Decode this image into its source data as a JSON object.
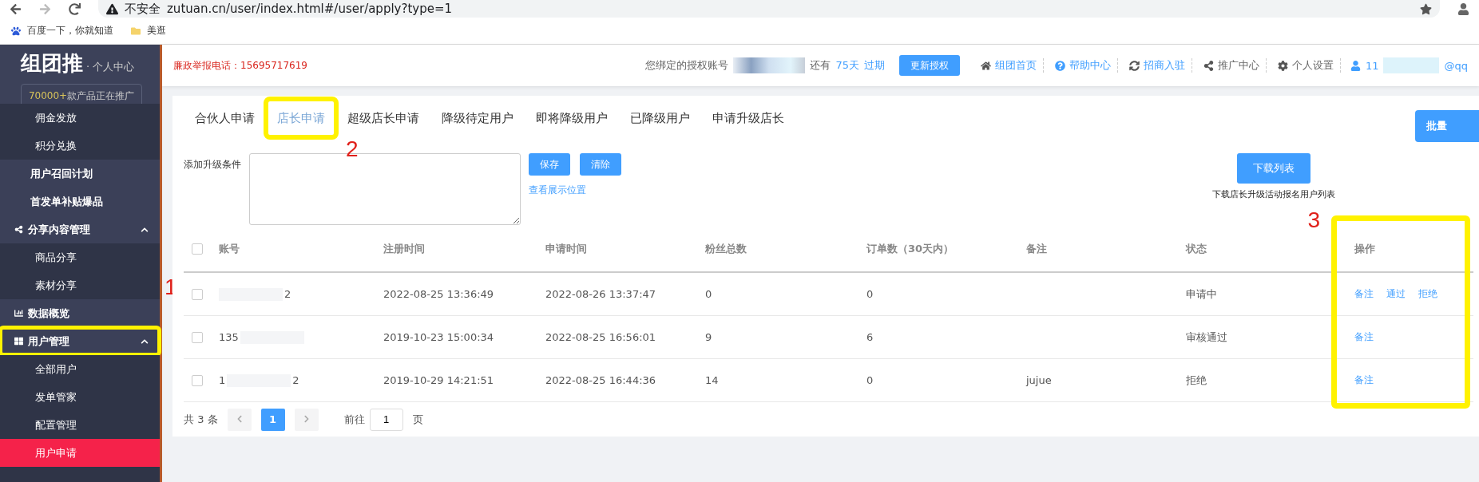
{
  "browser": {
    "security": "不安全",
    "url": "zutuan.cn/user/index.html#/user/apply?type=1",
    "bookmarks": [
      {
        "label": "百度一下，你就知道",
        "kind": "paw"
      },
      {
        "label": "美逛",
        "kind": "folder"
      }
    ]
  },
  "sidebar": {
    "logo": "组团推",
    "subtitle": "· 个人中心",
    "promo_count": "70000+",
    "promo_text": "款产品正在推广",
    "items": [
      {
        "label": "佣金发放",
        "kind": "sub",
        "selected": false
      },
      {
        "label": "积分兑换",
        "kind": "sub",
        "selected": false
      },
      {
        "label": "用户召回计划",
        "kind": "plain",
        "selected": false
      },
      {
        "label": "首发单补贴爆品",
        "kind": "plain",
        "selected": false
      },
      {
        "label": "分享内容管理",
        "kind": "share",
        "expanded": true,
        "selected": false,
        "children": [
          {
            "label": "商品分享",
            "selected": false
          },
          {
            "label": "素材分享",
            "selected": false
          }
        ]
      },
      {
        "label": "数据概览",
        "kind": "chart",
        "selected": false
      },
      {
        "label": "用户管理",
        "kind": "grid",
        "expanded": true,
        "selected": false,
        "highlighted": true,
        "marker": "1",
        "children": [
          {
            "label": "全部用户",
            "selected": false
          },
          {
            "label": "发单管家",
            "selected": false
          },
          {
            "label": "配置管理",
            "selected": false
          },
          {
            "label": "用户申请",
            "selected": true
          }
        ]
      }
    ]
  },
  "header": {
    "hotline": "廉政举报电话：15695717619",
    "bound_label": "您绑定的授权账号",
    "remaining": "还有",
    "days": "75天",
    "expire": "过期",
    "renew": "更新授权",
    "links": [
      {
        "label": "组团首页",
        "kind": "home"
      },
      {
        "label": "帮助中心",
        "kind": "help"
      },
      {
        "label": "招商入驻",
        "kind": "refresh"
      },
      {
        "label": "推广中心",
        "kind": "share"
      },
      {
        "label": "个人设置",
        "kind": "gear"
      }
    ],
    "user_start": "11",
    "user_end": "@qq"
  },
  "tabs": [
    {
      "label": "合伙人申请",
      "selected": false
    },
    {
      "label": "店长申请",
      "selected": true,
      "highlighted": true,
      "marker": "2"
    },
    {
      "label": "超级店长申请",
      "selected": false
    },
    {
      "label": "降级待定用户",
      "selected": false
    },
    {
      "label": "即将降级用户",
      "selected": false
    },
    {
      "label": "已降级用户",
      "selected": false
    },
    {
      "label": "申请升级店长",
      "selected": false
    }
  ],
  "batch_button": "批量",
  "condition": {
    "label": "添加升级条件",
    "save": "保存",
    "clear": "清除",
    "view_link": "查看展示位置"
  },
  "download": {
    "button": "下载列表",
    "caption": "下载店长升级活动报名用户列表"
  },
  "table": {
    "select_all_checked": false,
    "columns": [
      {
        "label": "账号"
      },
      {
        "label": "注册时间"
      },
      {
        "label": "申请时间"
      },
      {
        "label": "粉丝总数"
      },
      {
        "label": "订单数（30天内）"
      },
      {
        "label": "备注"
      },
      {
        "label": "状态"
      },
      {
        "label": "操作",
        "highlighted": true,
        "marker": "3"
      }
    ],
    "rows": [
      {
        "checked": false,
        "account_start": "",
        "account_end": "2",
        "registered": "2022-08-25 13:36:49",
        "applied": "2022-08-26 13:37:47",
        "fans": "0",
        "orders": "0",
        "note": "",
        "status": "申请中",
        "actions": [
          "备注",
          "通过",
          "拒绝"
        ]
      },
      {
        "checked": false,
        "account_start": "135",
        "account_end": "",
        "registered": "2019-10-23 15:00:34",
        "applied": "2022-08-25 16:56:01",
        "fans": "9",
        "orders": "6",
        "note": "",
        "status": "审核通过",
        "actions": [
          "备注"
        ]
      },
      {
        "checked": false,
        "account_start": "1",
        "account_end": "2",
        "registered": "2019-10-29 14:21:51",
        "applied": "2022-08-25 16:44:36",
        "fans": "14",
        "orders": "0",
        "note": "jujue",
        "status": "拒绝",
        "actions": [
          "备注"
        ]
      }
    ]
  },
  "pagination": {
    "total": "共 3 条",
    "pages": [
      {
        "label": "1",
        "selected": true
      }
    ],
    "goto": "前往",
    "page_input": "1",
    "page_unit": "页"
  }
}
